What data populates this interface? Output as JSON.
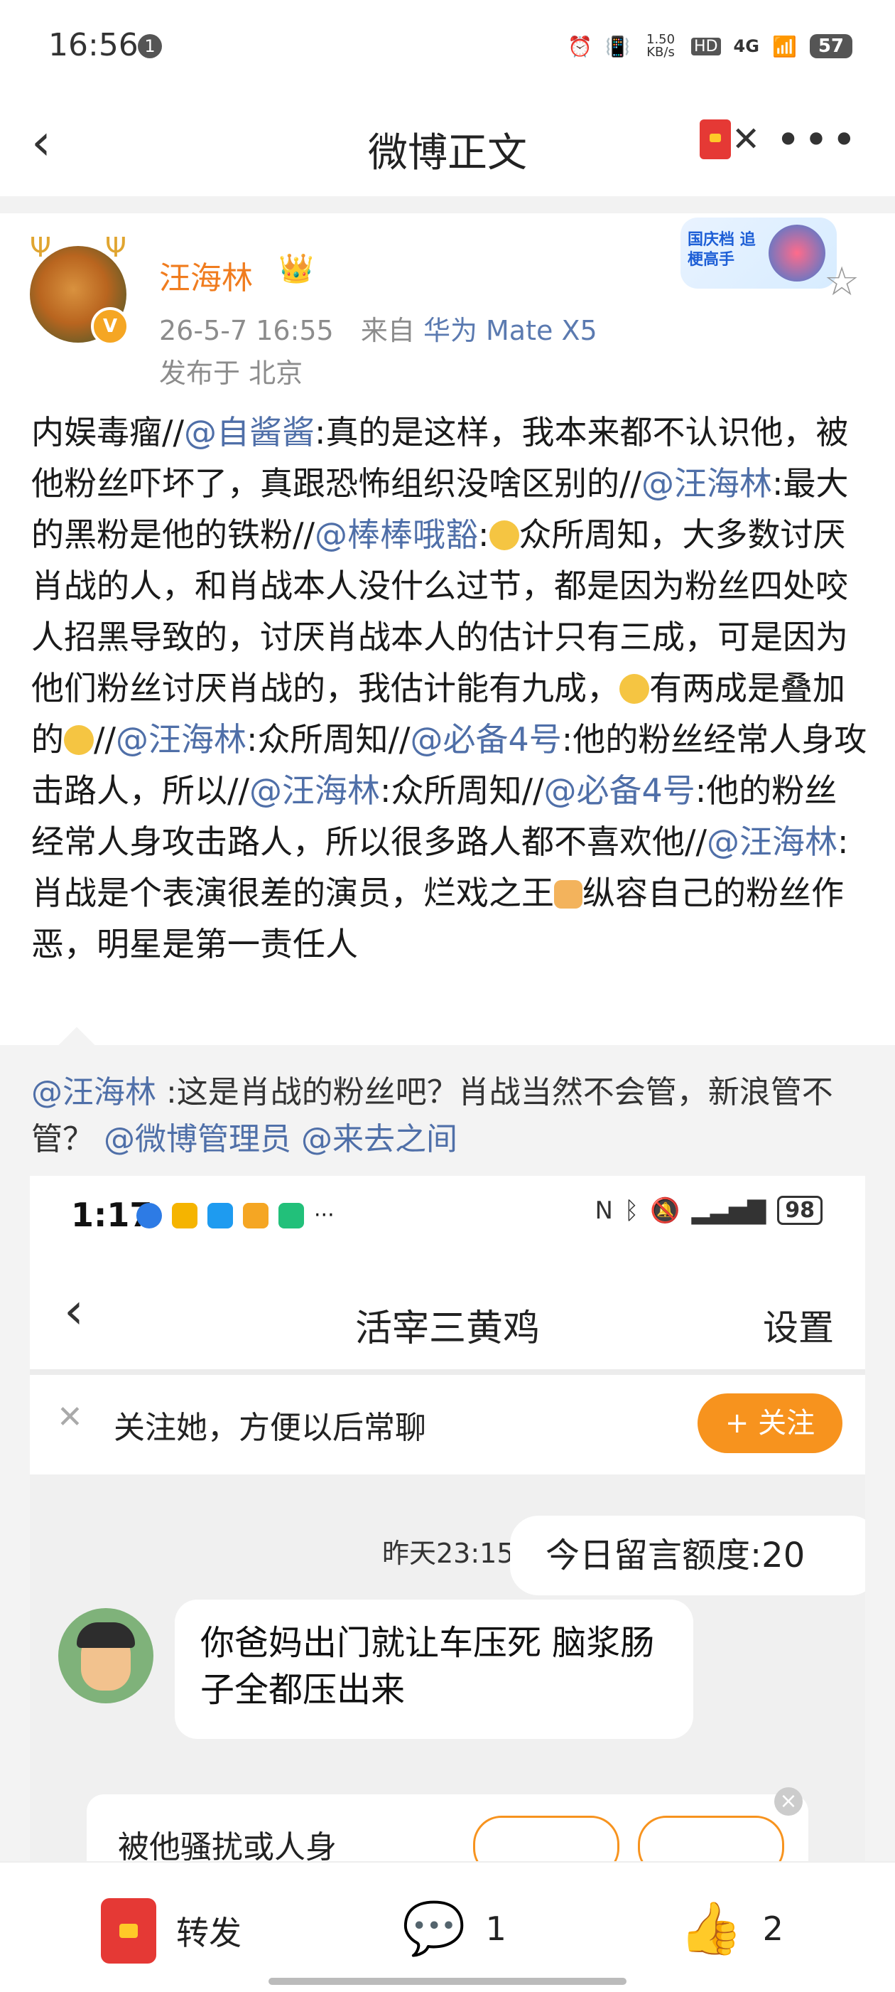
{
  "status": {
    "time": "16:56",
    "notif": "1",
    "speed": "1.50 KB/s",
    "hd": "HD",
    "net": "4G",
    "battery": "57"
  },
  "nav": {
    "title": "微博正文",
    "more": "•••",
    "back": "‹"
  },
  "post": {
    "username": "汪海林",
    "time": "26-5-7 16:55",
    "from_label": "来自",
    "device": "华为 Mate X5",
    "location": "发布于 北京",
    "badge": "国庆档 追梗高手",
    "body": [
      {
        "t": "内娱毒瘤//"
      },
      {
        "t": "@自酱酱",
        "at": true
      },
      {
        "t": ":真的是这样，我本来都不认识他，被他粉丝吓坏了，真跟恐怖组织没啥区别的//"
      },
      {
        "t": "@汪海林",
        "at": true
      },
      {
        "t": ":最大的黑粉是他的铁粉//"
      },
      {
        "t": "@棒棒哦豁",
        "at": true
      },
      {
        "t": ":"
      },
      {
        "emo": "face"
      },
      {
        "t": "众所周知，大多数讨厌肖战的人，和肖战本人没什么过节，都是因为粉丝四处咬人招黑导致的，讨厌肖战本人的估计只有三成，可是因为他们粉丝讨厌肖战的，我估计能有九成，"
      },
      {
        "emo": "face"
      },
      {
        "t": "有两成是叠加的"
      },
      {
        "emo": "face"
      },
      {
        "t": "//"
      },
      {
        "t": "@汪海林",
        "at": true
      },
      {
        "t": ":众所周知//"
      },
      {
        "t": "@必备4号",
        "at": true
      },
      {
        "t": ":他的粉丝经常人身攻击路人，所以//"
      },
      {
        "t": "@汪海林",
        "at": true
      },
      {
        "t": ":众所周知//"
      },
      {
        "t": "@必备4号",
        "at": true
      },
      {
        "t": ":他的粉丝经常人身攻击路人，所以很多路人都不喜欢他//"
      },
      {
        "t": "@汪海林",
        "at": true
      },
      {
        "t": ":肖战是个表演很差的演员，烂戏之王"
      },
      {
        "emo": "thumb"
      },
      {
        "t": "纵容自己的粉丝作恶，明星是第一责任人"
      }
    ]
  },
  "quote": {
    "author": "@汪海林",
    "text": " :这是肖战的粉丝吧？肖战当然不会管，新浪管不管？ ",
    "mention1": "@微博管理员",
    "mention2": "@来去之间"
  },
  "shot": {
    "time": "1:17",
    "battery": "98",
    "title": "活宰三黄鸡",
    "settings": "设置",
    "follow_hint": "关注她，方便以后常聊",
    "follow_btn": "+ 关注",
    "timestamp": "昨天23:15",
    "quota": "今日留言额度:20",
    "message": "你爸妈出门就让车压死 脑浆肠子全都压出来",
    "card_text": "被他骚扰或人身"
  },
  "toolbar": {
    "repost": "转发",
    "comments": "1",
    "likes": "2"
  }
}
